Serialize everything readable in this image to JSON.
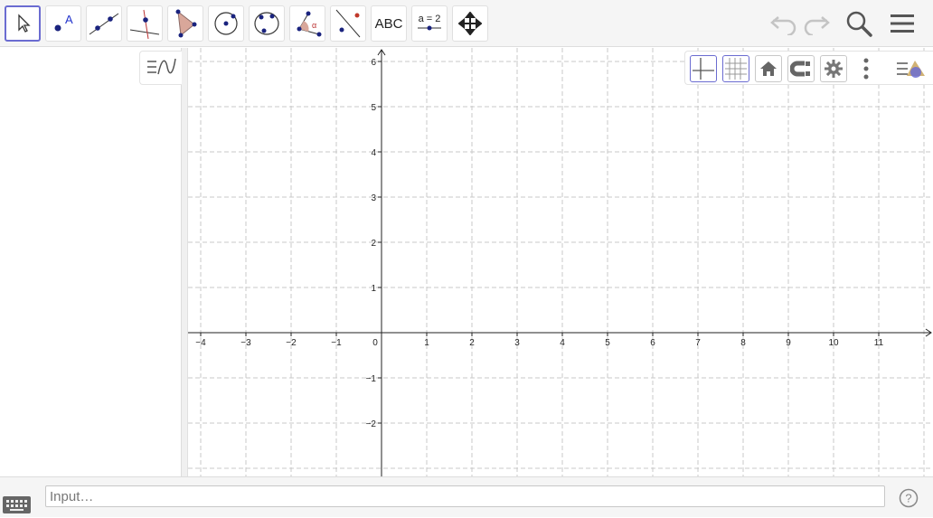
{
  "toolbar": {
    "tools": [
      {
        "name": "Move"
      },
      {
        "name": "Point",
        "label": "A"
      },
      {
        "name": "Line"
      },
      {
        "name": "Perpendicular Line"
      },
      {
        "name": "Polygon"
      },
      {
        "name": "Circle with Center through Point"
      },
      {
        "name": "Circle through 3 Points"
      },
      {
        "name": "Angle",
        "label": "α"
      },
      {
        "name": "Reflect about Line"
      },
      {
        "name": "Text",
        "label": "ABC"
      },
      {
        "name": "Slider",
        "label": "a = 2"
      },
      {
        "name": "Move Graphics View"
      }
    ],
    "undo_icon": "undo-icon",
    "redo_icon": "redo-icon",
    "search_icon": "search-icon",
    "menu_icon": "hamburger-menu-icon"
  },
  "style_bar": {
    "axes_toggle": "axes-icon",
    "grid_toggle": "grid-icon",
    "home": "home-icon",
    "point_capturing": "magnet-icon",
    "settings": "gear-icon",
    "more": "more-vertical-icon",
    "view_toggle": "graphics-view-icon"
  },
  "graphics": {
    "x_ticks": [
      "−4",
      "−3",
      "−2",
      "−1",
      "0",
      "1",
      "2",
      "3",
      "4",
      "5",
      "6",
      "7",
      "8",
      "9",
      "10",
      "11"
    ],
    "y_ticks": [
      "6",
      "5",
      "4",
      "3",
      "2",
      "1",
      "−1",
      "−2"
    ],
    "grid": true,
    "axes": true,
    "x_range": [
      -4.3,
      12.1
    ],
    "y_range": [
      -3.1,
      6.3
    ]
  },
  "input_bar": {
    "placeholder": "Input…",
    "keyboard_icon": "keyboard-icon",
    "help_icon": "help-icon"
  },
  "colors": {
    "accent": "#6b6cd1",
    "point": "#1a237e",
    "polygon_fill": "#d9a79a"
  }
}
